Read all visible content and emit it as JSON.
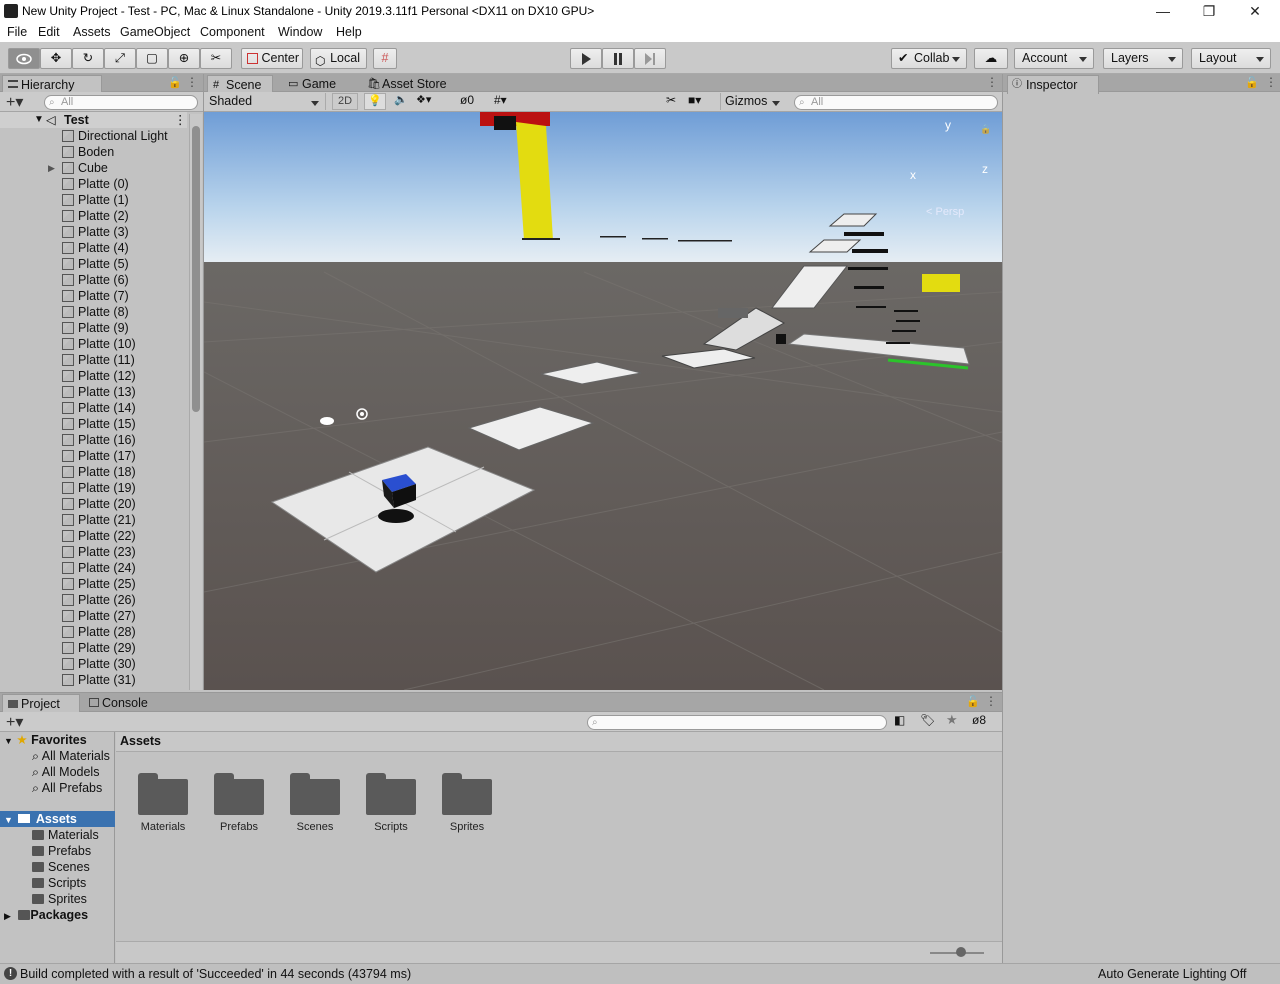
{
  "window": {
    "title": "New Unity Project - Test - PC, Mac & Linux Standalone - Unity 2019.3.11f1 Personal <DX11 on DX10 GPU>",
    "minimize": "—",
    "maximize": "❐",
    "close": "✕"
  },
  "menu": [
    "File",
    "Edit",
    "Assets",
    "GameObject",
    "Component",
    "Window",
    "Help"
  ],
  "toolbar": {
    "center_label": "Center",
    "local_label": "Local",
    "collab_label": "Collab",
    "account_label": "Account",
    "layers_label": "Layers",
    "layout_label": "Layout"
  },
  "hierarchy": {
    "tab_label": "Hierarchy",
    "search_placeholder": "All",
    "scene_name": "Test",
    "items": [
      "Directional Light",
      "Boden",
      "Cube",
      "Platte (0)",
      "Platte (1)",
      "Platte (2)",
      "Platte (3)",
      "Platte (4)",
      "Platte (5)",
      "Platte (6)",
      "Platte (7)",
      "Platte (8)",
      "Platte (9)",
      "Platte (10)",
      "Platte (11)",
      "Platte (12)",
      "Platte (13)",
      "Platte (14)",
      "Platte (15)",
      "Platte (16)",
      "Platte (17)",
      "Platte (18)",
      "Platte (19)",
      "Platte (20)",
      "Platte (21)",
      "Platte (22)",
      "Platte (23)",
      "Platte (24)",
      "Platte (25)",
      "Platte (26)",
      "Platte (27)",
      "Platte (28)",
      "Platte (29)",
      "Platte (30)",
      "Platte (31)"
    ]
  },
  "scene": {
    "tabs": [
      "Scene",
      "Game",
      "Asset Store"
    ],
    "shading_mode": "Shaded",
    "mode_2d": "2D",
    "hidden_count": "0",
    "gizmos_label": "Gizmos",
    "search_placeholder": "All",
    "axis_y": "y",
    "axis_x": "x",
    "axis_z": "z",
    "persp_label": "< Persp"
  },
  "inspector": {
    "tab_label": "Inspector"
  },
  "project": {
    "tabs": [
      "Project",
      "Console"
    ],
    "favorites_label": "Favorites",
    "favorites": [
      "All Materials",
      "All Models",
      "All Prefabs"
    ],
    "assets_label": "Assets",
    "asset_folders": [
      "Materials",
      "Prefabs",
      "Scenes",
      "Scripts",
      "Sprites"
    ],
    "packages_label": "Packages",
    "breadcrumb": "Assets",
    "hidden_count": "8"
  },
  "status": {
    "message": "Build completed with a result of 'Succeeded' in 44 seconds (43794 ms)",
    "right_text": "Auto Generate Lighting Off"
  }
}
